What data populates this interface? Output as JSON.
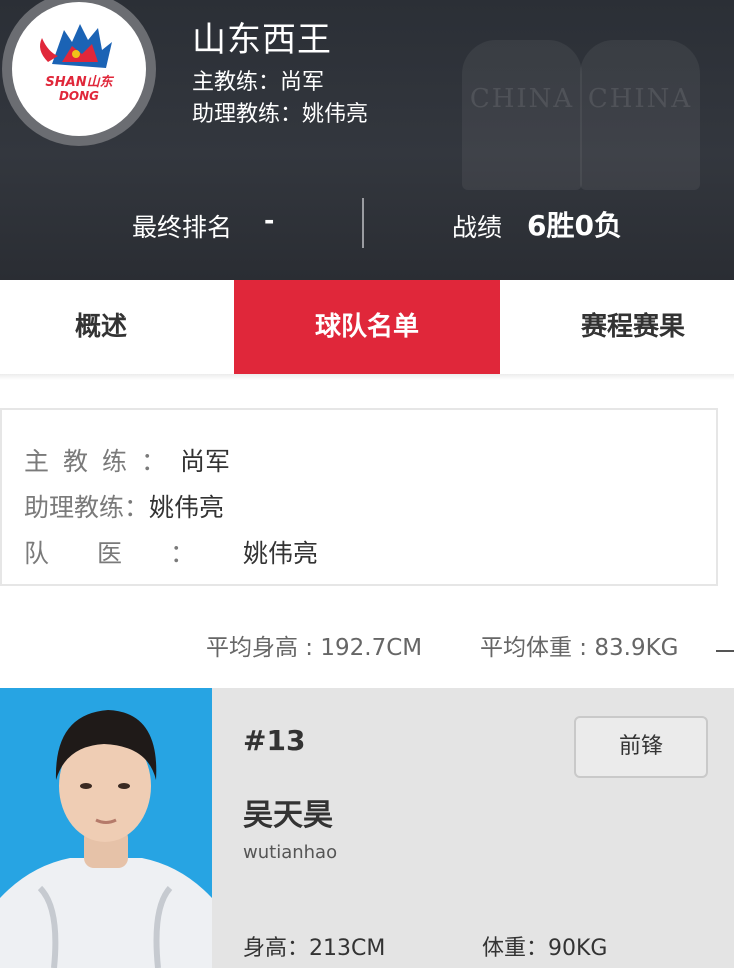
{
  "team": {
    "name": "山东西王",
    "logo_text_line1": "SHAN山东",
    "logo_text_line2": "DONG",
    "head_coach_line": "主教练：尚军",
    "assistant_coach_line": "助理教练：姚伟亮",
    "background_jersey_texts": [
      "CHINA",
      "CHINA"
    ]
  },
  "summary": {
    "rank_label": "最终排名",
    "rank_value": "-",
    "record_label": "战绩",
    "record_value": "6胜0负"
  },
  "tabs": [
    {
      "label": "概述",
      "active": false
    },
    {
      "label": "球队名单",
      "active": true
    },
    {
      "label": "赛程赛果",
      "active": false
    }
  ],
  "staff": [
    {
      "label": "主教练：",
      "value": "尚军"
    },
    {
      "label": "助理教练：",
      "value": "姚伟亮"
    },
    {
      "label": "队医：",
      "value": "姚伟亮"
    }
  ],
  "averages": {
    "height": "平均身高 : 192.7CM",
    "weight": "平均体重 : 83.9KG"
  },
  "player": {
    "number": "#13",
    "position": "前锋",
    "name": "吴天昊",
    "pinyin": "wutianhao",
    "height": "身高：213CM",
    "weight": "体重：90KG"
  },
  "colors": {
    "accent": "#e0273a",
    "header_bg": "#2e3238",
    "photo_bg": "#27a4e3",
    "card_bg": "#e4e4e4"
  }
}
